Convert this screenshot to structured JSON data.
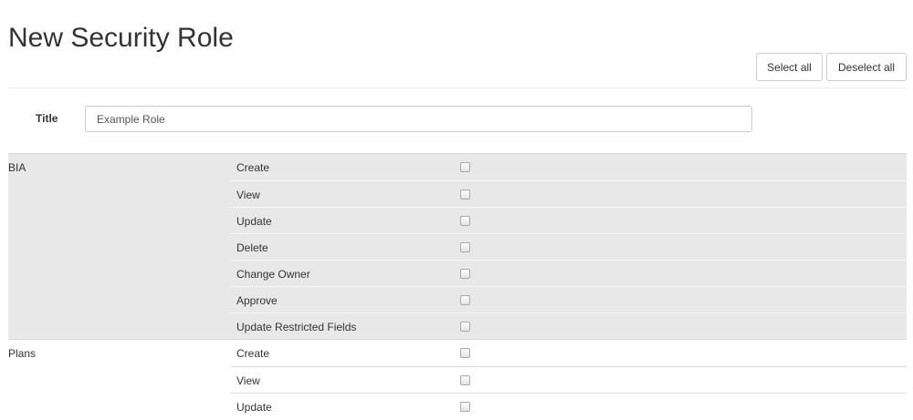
{
  "page": {
    "title": "New Security Role"
  },
  "toolbar": {
    "select_all_label": "Select all",
    "deselect_all_label": "Deselect all"
  },
  "form": {
    "title_label": "Title",
    "title_value": "Example Role"
  },
  "groups": [
    {
      "name": "BIA",
      "permissions": [
        {
          "label": "Create",
          "checked": false
        },
        {
          "label": "View",
          "checked": false
        },
        {
          "label": "Update",
          "checked": false
        },
        {
          "label": "Delete",
          "checked": false
        },
        {
          "label": "Change Owner",
          "checked": false
        },
        {
          "label": "Approve",
          "checked": false
        },
        {
          "label": "Update Restricted Fields",
          "checked": false
        }
      ]
    },
    {
      "name": "Plans",
      "permissions": [
        {
          "label": "Create",
          "checked": false
        },
        {
          "label": "View",
          "checked": false
        },
        {
          "label": "Update",
          "checked": false
        }
      ]
    }
  ],
  "colors": {
    "shaded_group_bg": "#e8e8e8",
    "text": "#333333",
    "border": "#cccccc"
  }
}
